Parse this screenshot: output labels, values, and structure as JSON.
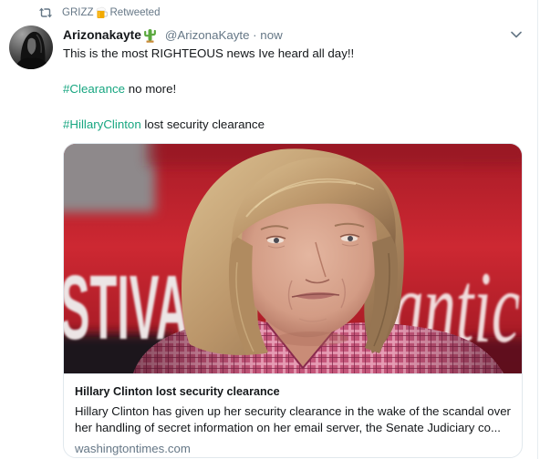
{
  "retweet_context": {
    "icon": "retweet-icon",
    "retweeter_name": "GRIZZ",
    "retweeter_name_emoji": "beer-mug-emoji-icon",
    "label": "Retweeted"
  },
  "tweet": {
    "author": {
      "name": "Arizonakayte",
      "name_emoji": "cactus-emoji-icon",
      "handle": "@ArizonaKayte",
      "separator": "·",
      "time": "now"
    },
    "menu_icon": "chevron-down-icon",
    "paragraphs": [
      {
        "text": "This is the most RIGHTEOUS news Ive heard all day!!"
      },
      {
        "hashtag": "#Clearance",
        "text": " no more!"
      },
      {
        "hashtag": "#HillaryClinton",
        "text": " lost security clearance"
      }
    ],
    "card": {
      "image": {
        "backdrop_text_left": "STIVA",
        "backdrop_text_right": "lantic"
      },
      "title": "Hillary Clinton lost security clearance",
      "description": "Hillary Clinton has given up her security clearance in the wake of the scandal over her handling of secret information on her email server, the Senate Judiciary co...",
      "domain": "washingtontimes.com"
    }
  },
  "colors": {
    "hashtag": "#17a680",
    "secondary_text": "#657786",
    "primary_text": "#14171a",
    "card_border": "#e1e8ed",
    "timeline_divider": "#e6ecf0"
  }
}
